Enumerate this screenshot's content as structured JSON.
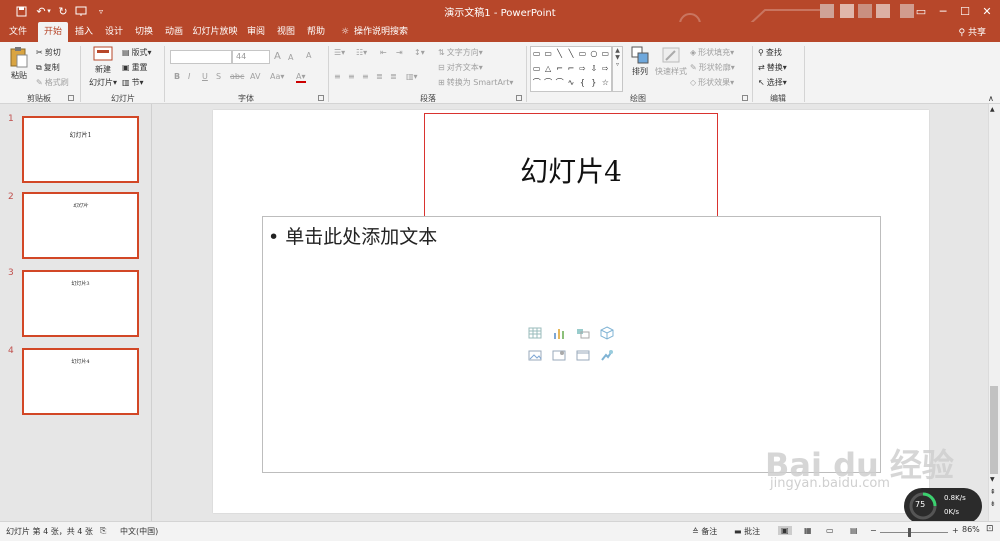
{
  "window": {
    "title": "演示文稿1 - PowerPoint",
    "share_label": "共享"
  },
  "tabs": [
    "文件",
    "开始",
    "插入",
    "设计",
    "切换",
    "动画",
    "幻灯片放映",
    "审阅",
    "视图",
    "帮助"
  ],
  "tell_me": "操作说明搜索",
  "ribbon": {
    "clipboard": {
      "label": "剪贴板",
      "paste": "粘贴",
      "cut": "剪切",
      "copy": "复制",
      "format_painter": "格式刷"
    },
    "slides": {
      "label": "幻灯片",
      "new_slide_line1": "新建",
      "new_slide_line2": "幻灯片▾",
      "layout": "版式▾",
      "reset": "重置",
      "section": "节▾"
    },
    "font": {
      "label": "字体",
      "font_name": "",
      "font_size": "44",
      "bold": "B",
      "italic": "I",
      "underline": "U",
      "shadow": "S",
      "strike": "abc",
      "spacing": "AV",
      "case": "Aa▾",
      "color": "A▾",
      "grow": "A",
      "shrink": "A",
      "clear": "A"
    },
    "paragraph": {
      "label": "段落",
      "text_direction": "文字方向▾",
      "align_text": "对齐文本▾",
      "smartart": "转换为 SmartArt▾"
    },
    "drawing": {
      "label": "绘图",
      "arrange": "排列",
      "quick_styles": "快速样式",
      "fill": "形状填充▾",
      "outline": "形状轮廓▾",
      "effects": "形状效果▾"
    },
    "editing": {
      "label": "编辑",
      "find": "查找",
      "replace": "替换▾",
      "select": "选择▾"
    }
  },
  "shape_glyphs": [
    "▭",
    "▭",
    "╲",
    "╲",
    "▭",
    "○",
    "▭",
    "▭",
    "△",
    "⌐",
    "⌐",
    "⇨",
    "⇩",
    "⇨",
    "⌒",
    "⌒",
    "⌒",
    "∿",
    "{",
    "}",
    "☆"
  ],
  "slides": [
    {
      "num": "1",
      "title": "幻灯片1"
    },
    {
      "num": "2",
      "title": "幻灯片"
    },
    {
      "num": "3",
      "title": "幻灯片3"
    },
    {
      "num": "4",
      "title": "幻灯片4"
    }
  ],
  "current_slide": {
    "title": "幻灯片4",
    "bullet": "• 单击此处添加文本"
  },
  "status": {
    "slide_info": "幻灯片 第 4 张，共 4 张",
    "language": "中文(中国)",
    "notes": "备注",
    "comments": "批注",
    "zoom": "86%"
  },
  "net_widget": {
    "value": "75",
    "up": "0.8K/s",
    "down": "0K/s"
  },
  "watermark": {
    "main": "Bai du 经验",
    "sub": "jingyan.baidu.com"
  },
  "colors": {
    "accent": "#b7472a",
    "selection": "#d24726",
    "title_border": "#d9332f"
  }
}
